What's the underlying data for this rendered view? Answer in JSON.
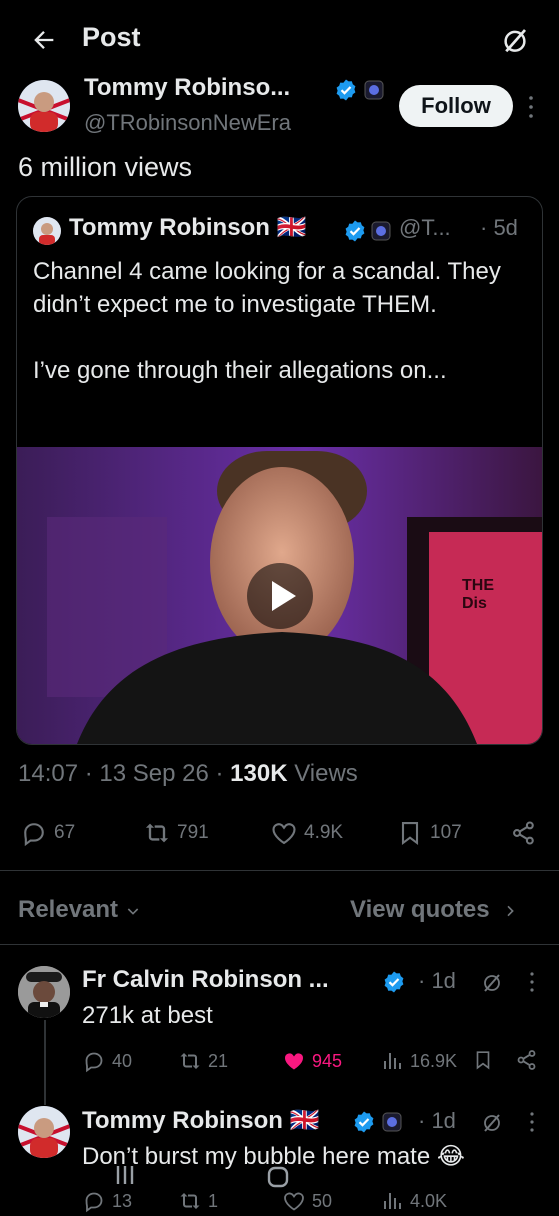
{
  "header": {
    "title": "Post",
    "back_icon": "arrow-left-icon",
    "grok_icon": "grok-icon"
  },
  "post": {
    "author_name": "Tommy Robinso...",
    "handle": "@TRobinsonNewEra",
    "follow_label": "Follow",
    "views_text": "6 million views"
  },
  "quote": {
    "author_name": "Tommy Robinson 🇬🇧",
    "handle": "@T...",
    "age": "· 5d",
    "text": "Channel 4 came looking for a scandal. They didn’t expect me to investigate THEM.\n\nI’ve gone through their allegations on...",
    "video_sign_text": "THE\nDis"
  },
  "meta": {
    "time": "14:07",
    "date": "13 Sep 26",
    "views_count": "130K",
    "views_label": "Views"
  },
  "actions": {
    "replies": "67",
    "reposts": "791",
    "likes": "4.9K",
    "bookmarks": "107"
  },
  "replies_section": {
    "sort_label": "Relevant",
    "view_quotes_label": "View quotes"
  },
  "replies": [
    {
      "name": "Fr Calvin Robinson ...",
      "age": "· 1d",
      "text": "271k at best",
      "reply_count": "40",
      "repost_count": "21",
      "like_count": "945",
      "view_count": "16.9K"
    },
    {
      "name": "Tommy Robinson 🇬🇧",
      "age": "· 1d",
      "text": "Don’t burst my bubble here mate 😂",
      "reply_count": "13",
      "repost_count": "1",
      "like_count": "50",
      "view_count": "4.0K"
    }
  ],
  "colors": {
    "background": "#000000",
    "text": "#e7e9ea",
    "muted": "#71767b",
    "verified": "#1d9bf0",
    "like_active": "#f91880"
  }
}
